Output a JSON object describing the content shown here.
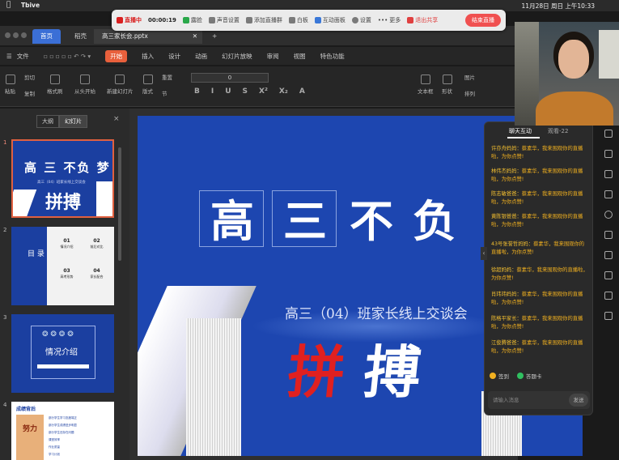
{
  "menubar": {
    "app_name": "Tbive",
    "clock": "11月28日 周日 上午10:33"
  },
  "livebar": {
    "live_label": "直播中",
    "timer": "00:00:19",
    "items": [
      "露脸",
      "声音设置",
      "添加直播群",
      "白板",
      "互动面板",
      "设置",
      "更多"
    ],
    "share_label": "退出共享",
    "end_label": "结束直播"
  },
  "tabs": {
    "home": "首页",
    "doc_short": "稻壳",
    "doc": "高三家长会.pptx",
    "add": "+"
  },
  "menu": {
    "file": "文件",
    "items": [
      "开始",
      "插入",
      "设计",
      "动画",
      "幻灯片放映",
      "审阅",
      "视图",
      "特色功能"
    ]
  },
  "ribbon": {
    "paste": "粘贴",
    "cut": "剪切",
    "copy": "复制",
    "format_painter": "格式刷",
    "from_start": "从头开始",
    "new_slide": "新建幻灯片",
    "layout": "版式",
    "section": "节",
    "reset": "重置",
    "font_size": "0",
    "textbox": "文本框",
    "shape": "形状",
    "arrange": "排列",
    "picture": "图片"
  },
  "left_panel": {
    "tab_outline": "大纲",
    "tab_slides": "幻灯片"
  },
  "slides": [
    {
      "num": "1",
      "title": "高 三 不负 梦",
      "sub": "高三（04）班家长线上交谈会",
      "big": "拼搏"
    },
    {
      "num": "2",
      "title": "目 录",
      "items": [
        "01",
        "02",
        "03",
        "04"
      ],
      "labels": [
        "情况介绍",
        "前后对比",
        "高考形势",
        "家长配合"
      ]
    },
    {
      "num": "3",
      "title": "情况介绍"
    },
    {
      "num": "4",
      "title": "成绩背后",
      "big": "努力",
      "bullets": [
        "部分学生学习态度端正",
        "部分学生成绩进步明显",
        "部分学生还存在问题",
        "课堂效率",
        "作业质量",
        "学习计划"
      ]
    }
  ],
  "main_slide": {
    "chars": [
      "高",
      "三",
      "不",
      "负"
    ],
    "subtitle": "高三（04）班家长线上交谈会",
    "big": [
      "拼",
      "搏"
    ]
  },
  "chat": {
    "tab_active": "聊天互动",
    "tab_other": "观看-22",
    "messages": [
      {
        "name": "许亦舟妈妈：",
        "text": "蔡素华，我来围观你的直播啦，为你点赞!"
      },
      {
        "name": "林伟杰妈妈：",
        "text": "蔡素华，我来围观你的直播啦，为你点赞!"
      },
      {
        "name": "陈志敏爸爸：",
        "text": "蔡素华，我来围观你的直播啦，为你点赞!"
      },
      {
        "name": "黄陈银爸爸：",
        "text": "蔡素华，我来围观你的直播啦，为你点赞!"
      },
      {
        "name": "43号张誉哲妈妈：",
        "text": "蔡素华，我来围观你的直播啦，为你点赞!"
      },
      {
        "name": "徐超妈妈：",
        "text": "蔡素华，我来围观你的直播啦，为你点赞!"
      },
      {
        "name": "肖玮玮妈妈：",
        "text": "蔡素华，我来围观你的直播啦，为你点赞!"
      },
      {
        "name": "陈格平家长：",
        "text": "蔡素华，我来围观你的直播啦，为你点赞!"
      },
      {
        "name": "江俊腾爸爸：",
        "text": "蔡素华，我来围观你的直播啦，为你点赞!"
      }
    ],
    "gift1": "签到",
    "gift2": "答题卡",
    "input_placeholder": "请输入消息",
    "send": "发送"
  }
}
